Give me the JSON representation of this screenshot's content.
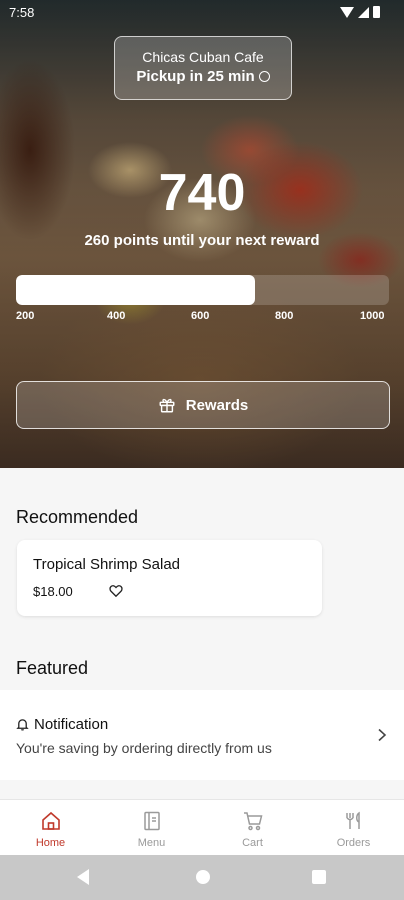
{
  "status_bar": {
    "time": "7:58"
  },
  "store": {
    "name": "Chicas Cuban Cafe",
    "pickup": "Pickup in 25 min"
  },
  "loyalty": {
    "points": "740",
    "points_message": "260 points until your next reward",
    "progress_fraction": 0.64,
    "ticks": [
      "200",
      "400",
      "600",
      "800",
      "1000"
    ],
    "rewards_button": "Rewards"
  },
  "recommended": {
    "title": "Recommended",
    "items": [
      {
        "name": "Tropical Shrimp Salad",
        "price": "$18.00"
      }
    ]
  },
  "featured": {
    "title": "Featured",
    "notification": {
      "title": "Notification",
      "text": "You're saving by ordering directly from us"
    }
  },
  "bottom_nav": {
    "items": [
      {
        "label": "Home",
        "icon": "home-icon",
        "active": true
      },
      {
        "label": "Menu",
        "icon": "menu-icon",
        "active": false
      },
      {
        "label": "Cart",
        "icon": "cart-icon",
        "active": false
      },
      {
        "label": "Orders",
        "icon": "orders-icon",
        "active": false
      }
    ]
  },
  "colors": {
    "accent": "#c0392b",
    "inactive": "#9a9a9a"
  }
}
